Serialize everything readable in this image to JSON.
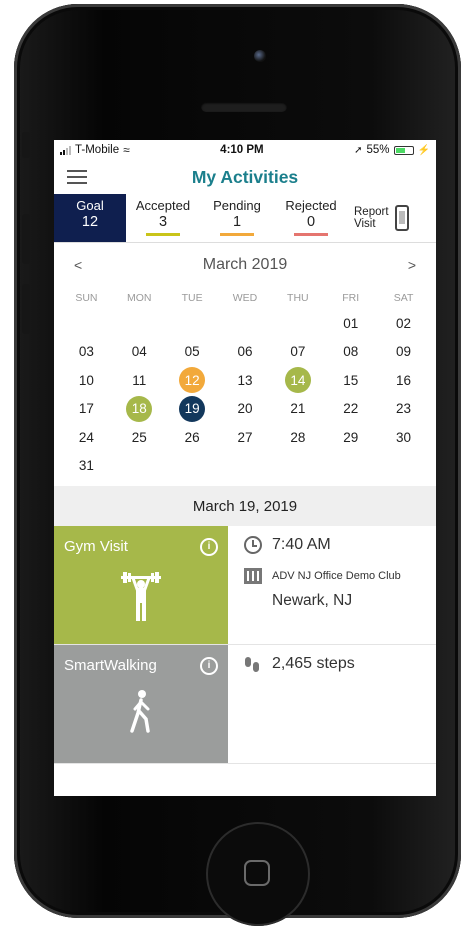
{
  "status_bar": {
    "carrier": "T-Mobile",
    "time": "4:10 PM",
    "battery": "55%"
  },
  "nav": {
    "title": "My Activities",
    "menu_icon": "hamburger-icon"
  },
  "tabs": {
    "goal": {
      "label": "Goal",
      "value": "12"
    },
    "accepted": {
      "label": "Accepted",
      "value": "3",
      "color": "#c9c419"
    },
    "pending": {
      "label": "Pending",
      "value": "1",
      "color": "#f2a93b"
    },
    "rejected": {
      "label": "Rejected",
      "value": "0",
      "color": "#e5756f"
    },
    "report": {
      "label_line1": "Report",
      "label_line2": "Visit",
      "icon": "phone-tap-icon"
    }
  },
  "calendar": {
    "month": "March 2019",
    "prev": "<",
    "next": ">",
    "weekdays": [
      "SUN",
      "MON",
      "TUE",
      "WED",
      "THU",
      "FRI",
      "SAT"
    ],
    "days": [
      "",
      "",
      "",
      "",
      "",
      "01",
      "02",
      "03",
      "04",
      "05",
      "06",
      "07",
      "08",
      "09",
      "10",
      "11",
      "12",
      "13",
      "14",
      "15",
      "16",
      "17",
      "18",
      "19",
      "20",
      "21",
      "22",
      "23",
      "24",
      "25",
      "26",
      "27",
      "28",
      "29",
      "30",
      "31"
    ],
    "highlights": {
      "12": "#f2a93b",
      "14": "#a6b84a",
      "18": "#a6b84a",
      "19": "#13385c"
    }
  },
  "selected_date": "March 19, 2019",
  "activities": [
    {
      "name": "Gym Visit",
      "color": "#a6b84a",
      "icon": "weightlifter-icon",
      "time": "7:40 AM",
      "location": "ADV NJ Office Demo Club",
      "city": "Newark, NJ"
    },
    {
      "name": "SmartWalking",
      "color": "#9b9d9c",
      "icon": "walking-person-icon",
      "steps": "2,465 steps"
    }
  ]
}
